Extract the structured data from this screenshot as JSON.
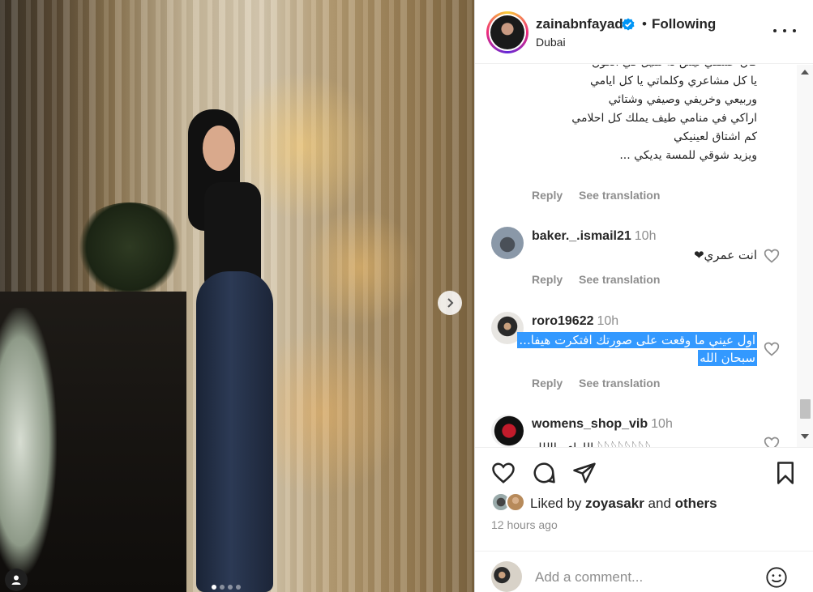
{
  "post": {
    "username": "zainabnfayad",
    "separator": "•",
    "follow_status": "Following",
    "location": "Dubai",
    "caption_lines": [
      "فان عشقي ليس له مثيل في الكون",
      "يا كل مشاعري وكلماتي يا كل ايامي",
      "وربيعي وخريفي وصيفي وشتائي",
      "اراكي في منامي طيف يملك كل احلامي",
      "كم اشتاق لعينيكي",
      "ويزيد شوقي للمسة يديكي ..."
    ],
    "caption_actions": {
      "reply": "Reply",
      "translate": "See translation"
    },
    "carousel": {
      "slide_count": 4,
      "active_index": 0
    }
  },
  "comments": [
    {
      "username": "baker._.ismail21",
      "time": "10h",
      "text": "انت عمري❤",
      "reply": "Reply",
      "translate": "See translation"
    },
    {
      "username": "roro19622",
      "time": "10h",
      "text_line1": "اول عيني ما وقعت على صورتك افتكرت هيفا...",
      "text_line2": "سبحان الله",
      "reply": "Reply",
      "translate": "See translation"
    },
    {
      "username": "womens_shop_vib",
      "time": "10h",
      "text": "اللهاء مااللله 𓆩𓆩𓆩𓆩𓆩𓆩𓆩𓆩"
    }
  ],
  "likes": {
    "prefix": "Liked by ",
    "user": "zoyasakr",
    "middle": " and ",
    "others": "others"
  },
  "time_ago": "12 hours ago",
  "add_comment": {
    "placeholder": "Add a comment..."
  },
  "colors": {
    "accent": "#0095f6",
    "highlight": "#3399ff",
    "muted": "#8e8e8e",
    "text": "#262626"
  }
}
